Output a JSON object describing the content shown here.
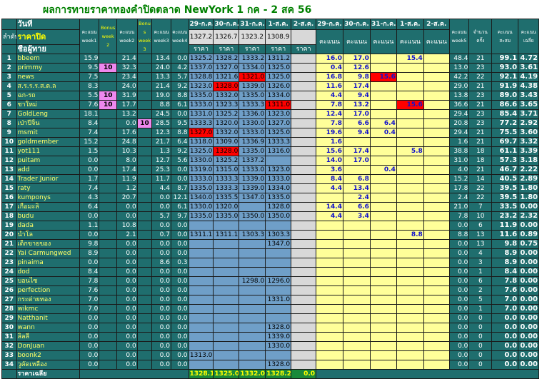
{
  "title": "ผลการทายราคาทองคำปิดตลาด NewYork 1 กค - 2 สค 56",
  "header": {
    "rank_label": "ลำดับ",
    "day_label": "วันที่",
    "close_label": "ราคาปิด",
    "player_label": "ชื่อผู้ทาย",
    "col_week1": "คะแนน week1",
    "col_bonus2": "Bonus week 2",
    "col_week2": "คะแนน week2",
    "col_bonus3": "Bonu s week 3",
    "col_week3": "คะแนน week3",
    "col_week4": "คะแนน week4",
    "date_cols": [
      "29-ก.ค.",
      "30-ก.ค.",
      "31-ก.ค.",
      "1-ส.ค.",
      "2-ส.ค."
    ],
    "closing_prices": [
      "1327.2",
      "1326.7",
      "1323.2",
      "1308.9",
      ""
    ],
    "price_label": "ราคา",
    "score_label": "คะแนน",
    "col_week5": "คะแนน week5",
    "col_count": "จำนวนครั้ง",
    "col_total": "คะแนนสะสม",
    "col_avg": "คะแนนเฉลี่ย"
  },
  "rows": [
    {
      "n": "1",
      "name": "bbeem",
      "w1": "15.9",
      "b2": "",
      "w2": "21.4",
      "b3": "",
      "w3": "13.4",
      "w4": "0.0",
      "p": [
        "1325.2",
        "1328.2",
        "1333.2",
        "1311.2",
        ""
      ],
      "s": [
        "16.0",
        "17.0",
        "",
        "15.4",
        ""
      ],
      "w5": "48.4",
      "cnt": "21",
      "tot": "99.1",
      "avg": "4.72"
    },
    {
      "n": "2",
      "name": "primmy",
      "w1": "9.5",
      "b2": "10",
      "w2": "32.3",
      "b3": "",
      "w3": "24.0",
      "w4": "4.2",
      "p": [
        "1337.0",
        "1327.0",
        "1334.0",
        "1325.0",
        ""
      ],
      "s": [
        "0.4",
        "12.6",
        "",
        "",
        ""
      ],
      "w5": "13.0",
      "cnt": "23",
      "tot": "93.0",
      "avg": "3.61"
    },
    {
      "n": "3",
      "name": "news",
      "w1": "7.5",
      "b2": "",
      "w2": "23.4",
      "b3": "",
      "w3": "13.3",
      "w4": "5.7",
      "p": [
        "1328.8",
        "1321.6",
        "1321.0",
        "1325.0",
        ""
      ],
      "s": [
        "16.8",
        "9.8",
        "15.6",
        "",
        ""
      ],
      "w5": "42.2",
      "cnt": "22",
      "tot": "92.1",
      "avg": "4.19"
    },
    {
      "n": "4",
      "name": "ส.ร.ร.ร.ส.ต.ล",
      "w1": "8.3",
      "b2": "",
      "w2": "24.0",
      "b3": "",
      "w3": "21.4",
      "w4": "9.2",
      "p": [
        "1323.0",
        "1328.0",
        "1339.0",
        "1326.0",
        ""
      ],
      "s": [
        "11.6",
        "17.4",
        "",
        "",
        ""
      ],
      "w5": "29.0",
      "cnt": "21",
      "tot": "91.9",
      "avg": "4.38"
    },
    {
      "n": "5",
      "name": "ฉก-รถ",
      "w1": "5.5",
      "b2": "10",
      "w2": "31.9",
      "b3": "",
      "w3": "19.0",
      "w4": "8.8",
      "p": [
        "1335.0",
        "1332.0",
        "1335.0",
        "1334.0",
        ""
      ],
      "s": [
        "4.4",
        "9.4",
        "",
        "",
        ""
      ],
      "w5": "13.8",
      "cnt": "23",
      "tot": "89.0",
      "avg": "3.43"
    },
    {
      "n": "6",
      "name": "ชาใหม่",
      "w1": "7.6",
      "b2": "10",
      "w2": "17.7",
      "b3": "",
      "w3": "8.8",
      "w4": "6.1",
      "p": [
        "1333.0",
        "1323.3",
        "1333.3",
        "1311.0",
        ""
      ],
      "s": [
        "7.8",
        "13.2",
        "",
        "15.6",
        ""
      ],
      "w5": "36.6",
      "cnt": "21",
      "tot": "86.6",
      "avg": "3.65"
    },
    {
      "n": "7",
      "name": "GoldLeng",
      "w1": "18.1",
      "b2": "",
      "w2": "13.2",
      "b3": "",
      "w3": "24.5",
      "w4": "0.0",
      "p": [
        "1331.0",
        "1325.2",
        "1336.0",
        "1323.0",
        ""
      ],
      "s": [
        "12.4",
        "17.0",
        "",
        "",
        ""
      ],
      "w5": "29.4",
      "cnt": "23",
      "tot": "85.4",
      "avg": "3.71"
    },
    {
      "n": "8",
      "name": "เป่าปี่จิ้น",
      "w1": "8.4",
      "b2": "",
      "w2": "0.0",
      "b3": "10",
      "w3": "28.5",
      "w4": "9.5",
      "p": [
        "1333.3",
        "1320.0",
        "1330.0",
        "1327.0",
        ""
      ],
      "s": [
        "7.8",
        "6.6",
        "6.4",
        "",
        ""
      ],
      "w5": "20.8",
      "cnt": "23",
      "tot": "77.2",
      "avg": "2.92"
    },
    {
      "n": "9",
      "name": "msmit",
      "w1": "7.4",
      "b2": "",
      "w2": "17.6",
      "b3": "",
      "w3": "12.3",
      "w4": "8.8",
      "p": [
        "1327.0",
        "1332.0",
        "1333.0",
        "1325.0",
        ""
      ],
      "s": [
        "19.6",
        "9.4",
        "0.4",
        "",
        ""
      ],
      "w5": "29.4",
      "cnt": "21",
      "tot": "75.5",
      "avg": "3.60"
    },
    {
      "n": "10",
      "name": "goldmember",
      "w1": "15.2",
      "b2": "",
      "w2": "24.8",
      "b3": "",
      "w3": "21.7",
      "w4": "6.4",
      "p": [
        "1318.0",
        "1309.0",
        "1336.9",
        "1333.3",
        ""
      ],
      "s": [
        "1.6",
        "",
        "",
        "",
        ""
      ],
      "w5": "1.6",
      "cnt": "21",
      "tot": "69.7",
      "avg": "3.32"
    },
    {
      "n": "11",
      "name": "yot111",
      "w1": "1.5",
      "b2": "",
      "w2": "10.3",
      "b3": "",
      "w3": "1.3",
      "w4": "9.2",
      "p": [
        "1325.0",
        "1328.0",
        "1335.0",
        "1316.0",
        ""
      ],
      "s": [
        "15.6",
        "17.4",
        "",
        "5.8",
        ""
      ],
      "w5": "38.8",
      "cnt": "18",
      "tot": "61.1",
      "avg": "3.39"
    },
    {
      "n": "12",
      "name": "puitam",
      "w1": "0.0",
      "b2": "",
      "w2": "8.0",
      "b3": "",
      "w3": "12.7",
      "w4": "5.6",
      "p": [
        "1330.0",
        "1325.2",
        "1337.2",
        "",
        ""
      ],
      "s": [
        "14.0",
        "17.0",
        "",
        "",
        ""
      ],
      "w5": "31.0",
      "cnt": "18",
      "tot": "57.3",
      "avg": "3.18"
    },
    {
      "n": "13",
      "name": "add",
      "w1": "0.0",
      "b2": "",
      "w2": "17.4",
      "b3": "",
      "w3": "25.3",
      "w4": "0.0",
      "p": [
        "1319.0",
        "1315.0",
        "1333.0",
        "1323.0",
        ""
      ],
      "s": [
        "3.6",
        "",
        "0.4",
        "",
        ""
      ],
      "w5": "4.0",
      "cnt": "21",
      "tot": "46.7",
      "avg": "2.22"
    },
    {
      "n": "14",
      "name": "Trader Junior",
      "w1": "1.7",
      "b2": "",
      "w2": "11.9",
      "b3": "",
      "w3": "11.7",
      "w4": "0.0",
      "p": [
        "1333.0",
        "1333.3",
        "1339.0",
        "1333.0",
        ""
      ],
      "s": [
        "8.4",
        "6.8",
        "",
        "",
        ""
      ],
      "w5": "15.2",
      "cnt": "14",
      "tot": "40.5",
      "avg": "2.89"
    },
    {
      "n": "15",
      "name": "raty",
      "w1": "7.4",
      "b2": "",
      "w2": "1.2",
      "b3": "",
      "w3": "4.4",
      "w4": "8.7",
      "p": [
        "1335.0",
        "1333.3",
        "1339.0",
        "1334.0",
        ""
      ],
      "s": [
        "4.4",
        "13.4",
        "",
        "",
        ""
      ],
      "w5": "17.8",
      "cnt": "22",
      "tot": "39.5",
      "avg": "1.80"
    },
    {
      "n": "16",
      "name": "kumponys",
      "w1": "4.3",
      "b2": "",
      "w2": "20.7",
      "b3": "",
      "w3": "0.0",
      "w4": "12.1",
      "p": [
        "1340.0",
        "1335.5",
        "1347.0",
        "1335.0",
        ""
      ],
      "s": [
        "",
        "2.4",
        "",
        "",
        ""
      ],
      "w5": "2.4",
      "cnt": "22",
      "tot": "39.5",
      "avg": "1.80"
    },
    {
      "n": "17",
      "name": "เกื้อมะลิ",
      "w1": "6.4",
      "b2": "",
      "w2": "0.0",
      "b3": "",
      "w3": "0.0",
      "w4": "6.1",
      "p": [
        "1330.0",
        "1320.0",
        "",
        "1328.0",
        ""
      ],
      "s": [
        "14.4",
        "6.6",
        "",
        "",
        ""
      ],
      "w5": "21.0",
      "cnt": "7",
      "tot": "33.5",
      "avg": "0.00"
    },
    {
      "n": "18",
      "name": "budu",
      "w1": "0.0",
      "b2": "",
      "w2": "0.0",
      "b3": "",
      "w3": "5.7",
      "w4": "9.7",
      "p": [
        "1335.0",
        "1335.0",
        "1350.0",
        "1350.0",
        ""
      ],
      "s": [
        "4.4",
        "3.4",
        "",
        "",
        ""
      ],
      "w5": "7.8",
      "cnt": "10",
      "tot": "23.2",
      "avg": "2.32"
    },
    {
      "n": "19",
      "name": "dada",
      "w1": "1.1",
      "b2": "",
      "w2": "10.8",
      "b3": "",
      "w3": "0.0",
      "w4": "0.0",
      "p": [
        "",
        "",
        "",
        "",
        ""
      ],
      "s": [
        "",
        "",
        "",
        "",
        ""
      ],
      "w5": "0.0",
      "cnt": "6",
      "tot": "11.9",
      "avg": "0.00"
    },
    {
      "n": "20",
      "name": "นำโล",
      "w1": "0.0",
      "b2": "",
      "w2": "2.1",
      "b3": "",
      "w3": "0.7",
      "w4": "0.0",
      "p": [
        "1311.1",
        "1311.1",
        "1303.3",
        "1303.3",
        ""
      ],
      "s": [
        "",
        "",
        "",
        "8.8",
        ""
      ],
      "w5": "8.8",
      "cnt": "13",
      "tot": "11.6",
      "avg": "0.89"
    },
    {
      "n": "21",
      "name": "เด็กขายของ",
      "w1": "9.8",
      "b2": "",
      "w2": "0.0",
      "b3": "",
      "w3": "0.0",
      "w4": "0.0",
      "p": [
        "",
        "",
        "",
        "1347.0",
        ""
      ],
      "s": [
        "",
        "",
        "",
        "",
        ""
      ],
      "w5": "0.0",
      "cnt": "13",
      "tot": "9.8",
      "avg": "0.75"
    },
    {
      "n": "22",
      "name": "Yai Carmungwed",
      "w1": "8.9",
      "b2": "",
      "w2": "0.0",
      "b3": "",
      "w3": "0.0",
      "w4": "0.0",
      "p": [
        "",
        "",
        "",
        "",
        ""
      ],
      "s": [
        "",
        "",
        "",
        "",
        ""
      ],
      "w5": "0.0",
      "cnt": "4",
      "tot": "8.9",
      "avg": "0.00"
    },
    {
      "n": "23",
      "name": "pinaima",
      "w1": "0.0",
      "b2": "",
      "w2": "0.0",
      "b3": "",
      "w3": "8.6",
      "w4": "0.3",
      "p": [
        "",
        "",
        "",
        "",
        ""
      ],
      "s": [
        "",
        "",
        "",
        "",
        ""
      ],
      "w5": "0.0",
      "cnt": "3",
      "tot": "8.9",
      "avg": "0.00"
    },
    {
      "n": "24",
      "name": "dod",
      "w1": "8.4",
      "b2": "",
      "w2": "0.0",
      "b3": "",
      "w3": "0.0",
      "w4": "0.0",
      "p": [
        "",
        "",
        "",
        "",
        ""
      ],
      "s": [
        "",
        "",
        "",
        "",
        ""
      ],
      "w5": "0.0",
      "cnt": "1",
      "tot": "8.4",
      "avg": "0.00"
    },
    {
      "n": "25",
      "name": "บอนไซ",
      "w1": "7.8",
      "b2": "",
      "w2": "0.0",
      "b3": "",
      "w3": "0.0",
      "w4": "0.0",
      "p": [
        "",
        "",
        "1298.0",
        "1296.0",
        ""
      ],
      "s": [
        "",
        "",
        "",
        "",
        ""
      ],
      "w5": "0.0",
      "cnt": "6",
      "tot": "7.8",
      "avg": "0.00"
    },
    {
      "n": "26",
      "name": "perfection",
      "w1": "7.6",
      "b2": "",
      "w2": "0.0",
      "b3": "",
      "w3": "0.0",
      "w4": "0.0",
      "p": [
        "",
        "",
        "",
        "",
        ""
      ],
      "s": [
        "",
        "",
        "",
        "",
        ""
      ],
      "w5": "0.0",
      "cnt": "2",
      "tot": "7.6",
      "avg": "0.00"
    },
    {
      "n": "27",
      "name": "กระต่ายทอง",
      "w1": "7.0",
      "b2": "",
      "w2": "0.0",
      "b3": "",
      "w3": "0.0",
      "w4": "0.0",
      "p": [
        "",
        "",
        "",
        "1331.0",
        ""
      ],
      "s": [
        "",
        "",
        "",
        "",
        ""
      ],
      "w5": "0.0",
      "cnt": "5",
      "tot": "7.0",
      "avg": "0.00"
    },
    {
      "n": "28",
      "name": "wikmc",
      "w1": "7.0",
      "b2": "",
      "w2": "0.0",
      "b3": "",
      "w3": "0.0",
      "w4": "0.0",
      "p": [
        "",
        "",
        "",
        "",
        ""
      ],
      "s": [
        "",
        "",
        "",
        "",
        ""
      ],
      "w5": "0.0",
      "cnt": "1",
      "tot": "7.0",
      "avg": "0.00"
    },
    {
      "n": "29",
      "name": "Natthanit",
      "w1": "0.0",
      "b2": "",
      "w2": "0.0",
      "b3": "",
      "w3": "0.0",
      "w4": "0.0",
      "p": [
        "",
        "",
        "",
        "",
        ""
      ],
      "s": [
        "",
        "",
        "",
        "",
        ""
      ],
      "w5": "0.0",
      "cnt": "0",
      "tot": "0.0",
      "avg": "0.00"
    },
    {
      "n": "30",
      "name": "wann",
      "w1": "0.0",
      "b2": "",
      "w2": "0.0",
      "b3": "",
      "w3": "0.0",
      "w4": "0.0",
      "p": [
        "",
        "",
        "",
        "1328.0",
        ""
      ],
      "s": [
        "",
        "",
        "",
        "",
        ""
      ],
      "w5": "0.0",
      "cnt": "0",
      "tot": "0.0",
      "avg": "0.00"
    },
    {
      "n": "31",
      "name": "ลิลลี่",
      "w1": "0.0",
      "b2": "",
      "w2": "0.0",
      "b3": "",
      "w3": "0.0",
      "w4": "0.0",
      "p": [
        "",
        "",
        "",
        "1339.0",
        ""
      ],
      "s": [
        "",
        "",
        "",
        "",
        ""
      ],
      "w5": "0.0",
      "cnt": "0",
      "tot": "0.0",
      "avg": "0.00"
    },
    {
      "n": "32",
      "name": "DonJuan",
      "w1": "0.0",
      "b2": "",
      "w2": "0.0",
      "b3": "",
      "w3": "0.0",
      "w4": "0.0",
      "p": [
        "",
        "",
        "",
        "1330.0",
        ""
      ],
      "s": [
        "",
        "",
        "",
        "",
        ""
      ],
      "w5": "0.0",
      "cnt": "0",
      "tot": "0.0",
      "avg": "0.00"
    },
    {
      "n": "33",
      "name": "boonk2",
      "w1": "0.0",
      "b2": "",
      "w2": "0.0",
      "b3": "",
      "w3": "0.0",
      "w4": "0.0",
      "p": [
        "1313.0",
        "",
        "",
        "",
        ""
      ],
      "s": [
        "",
        "",
        "",
        "",
        ""
      ],
      "w5": "0.0",
      "cnt": "0",
      "tot": "0.0",
      "avg": "0.00"
    },
    {
      "n": "34",
      "name": "วูคัดเหลือง",
      "w1": "0.0",
      "b2": "",
      "w2": "0.0",
      "b3": "",
      "w3": "0.0",
      "w4": "0.0",
      "p": [
        "",
        "",
        "",
        "1328.0",
        ""
      ],
      "s": [
        "",
        "",
        "",
        "",
        ""
      ],
      "w5": "0.0",
      "cnt": "0",
      "tot": "0.0",
      "avg": "0.00"
    }
  ],
  "red_price_cells": [
    "3-2",
    "4-1",
    "6-3",
    "9-0",
    "11-1"
  ],
  "red_score_cells": [
    "3-2",
    "6-3"
  ],
  "footer": {
    "label": "ราคาเฉลี่ย",
    "averages": [
      "1328.1",
      "1325.0",
      "1332.0",
      "1328.2",
      "0.0"
    ]
  },
  "colors": {
    "header_teal": "#1f6e6e",
    "price_blue": "#6f9fc8",
    "score_yellow": "#ffff99",
    "bonus_magenta": "#ee88ee",
    "highlight_red": "#ff0000",
    "footer_green": "#1a8a3a",
    "title_green": "#008000"
  }
}
